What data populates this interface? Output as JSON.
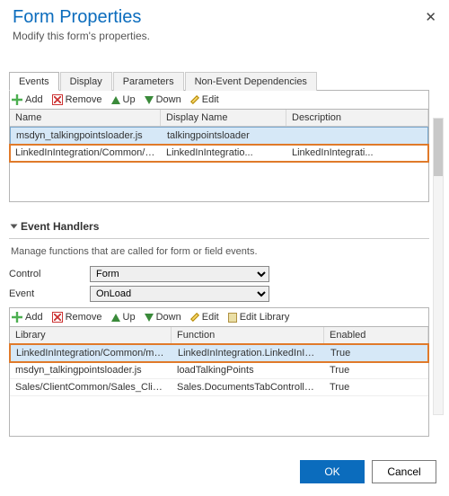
{
  "header": {
    "title": "Form Properties",
    "subtitle": "Modify this form's properties."
  },
  "tabs": [
    "Events",
    "Display",
    "Parameters",
    "Non-Event Dependencies"
  ],
  "activeTab": 0,
  "libToolbar": {
    "add": "Add",
    "remove": "Remove",
    "up": "Up",
    "down": "Down",
    "edit": "Edit"
  },
  "libGrid": {
    "cols": [
      "Name",
      "Display Name",
      "Description"
    ],
    "rows": [
      {
        "name": "msdyn_talkingpointsloader.js",
        "display": "talkingpointsloader",
        "desc": ""
      },
      {
        "name": "LinkedInIntegration/Common/msdyn_L...",
        "display": "LinkedInIntegratio...",
        "desc": "LinkedInIntegrati..."
      }
    ]
  },
  "eventHandlers": {
    "title": "Event Handlers",
    "hint": "Manage functions that are called for form or field events.",
    "controlLabel": "Control",
    "controlValue": "Form",
    "eventLabel": "Event",
    "eventValue": "OnLoad",
    "toolbar": {
      "add": "Add",
      "remove": "Remove",
      "up": "Up",
      "down": "Down",
      "edit": "Edit",
      "editLibrary": "Edit Library"
    },
    "grid": {
      "cols": [
        "Library",
        "Function",
        "Enabled"
      ],
      "rows": [
        {
          "lib": "LinkedInIntegration/Common/msdyn_L...",
          "fn": "LinkedInIntegration.LinkedInIntegration...",
          "en": "True"
        },
        {
          "lib": "msdyn_talkingpointsloader.js",
          "fn": "loadTalkingPoints",
          "en": "True"
        },
        {
          "lib": "Sales/ClientCommon/Sales_ClientCom...",
          "fn": "Sales.DocumentsTabController.shouldS...",
          "en": "True"
        }
      ]
    }
  },
  "footer": {
    "ok": "OK",
    "cancel": "Cancel"
  }
}
